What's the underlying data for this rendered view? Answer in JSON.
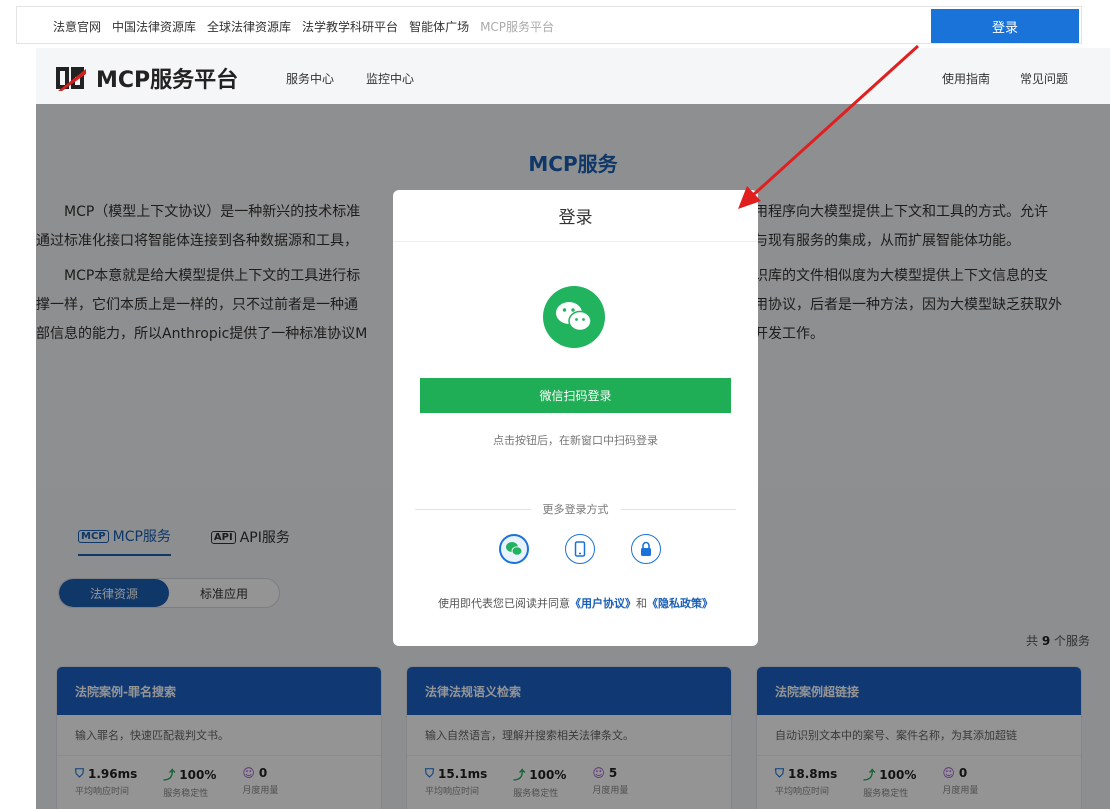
{
  "topbar": {
    "links": [
      "法意官网",
      "中国法律资源库",
      "全球法律资源库",
      "法学教学科研平台",
      "智能体广场"
    ],
    "current": "MCP服务平台",
    "login_label": "登录"
  },
  "nav": {
    "brand": "MCP服务平台",
    "left": [
      "服务中心",
      "监控中心"
    ],
    "right": [
      "使用指南",
      "常见问题"
    ]
  },
  "hero": {
    "title": "MCP服务",
    "para1_left": "MCP（模型上下文协议）是一种新兴的技术标准",
    "para1_right": "用程序向大模型提供上下文和工具的方式。允许",
    "para1_line2_left": "通过标准化接口将智能体连接到各种数据源和工具，",
    "para1_line2_right": "与现有服务的集成，从而扩展智能体功能。",
    "para2_left": "MCP本意就是给大模型提供上下文的工具进行标",
    "para2_right": "识库的文件相似度为大模型提供上下文信息的支",
    "para2_line2_left": "撑一样，它们本质上是一样的，只不过前者是一种通",
    "para2_line2_right": "用协议，后者是一种方法，因为大模型缺乏获取外",
    "para2_line3_left": "部信息的能力，所以Anthropic提供了一种标准协议M",
    "para2_line3_right": "开发工作。"
  },
  "tabs": [
    {
      "icon": "MCP",
      "label": "MCP服务"
    },
    {
      "icon": "API",
      "label": "API服务"
    }
  ],
  "segment": [
    "法律资源",
    "标准应用"
  ],
  "count": {
    "prefix": "共 ",
    "num": "9",
    "suffix": " 个服务"
  },
  "cards": [
    {
      "title": "法院案例-罪名搜索",
      "desc": "输入罪名，快速匹配裁判文书。",
      "s1": "1.96ms",
      "s2": "100%",
      "s3": "0"
    },
    {
      "title": "法律法规语义检索",
      "desc": "输入自然语言，理解并搜索相关法律条文。",
      "s1": "15.1ms",
      "s2": "100%",
      "s3": "5"
    },
    {
      "title": "法院案例超链接",
      "desc": "自动识别文本中的案号、案件名称，为其添加超链",
      "s1": "18.8ms",
      "s2": "100%",
      "s3": "0"
    }
  ],
  "stat_labels": [
    "平均响应时间",
    "服务稳定性",
    "月度用量"
  ],
  "modal": {
    "title": "登录",
    "wechat_button": "微信扫码登录",
    "hint": "点击按钮后，在新窗口中扫码登录",
    "more": "更多登录方式",
    "agree_prefix": "使用即代表您已阅读并同意",
    "agreement": "《用户协议》",
    "and": "和",
    "privacy": "《隐私政策》"
  },
  "colors": {
    "primary": "#1a73d9",
    "wechat": "#1fae55",
    "card_header": "#1d63c9"
  }
}
